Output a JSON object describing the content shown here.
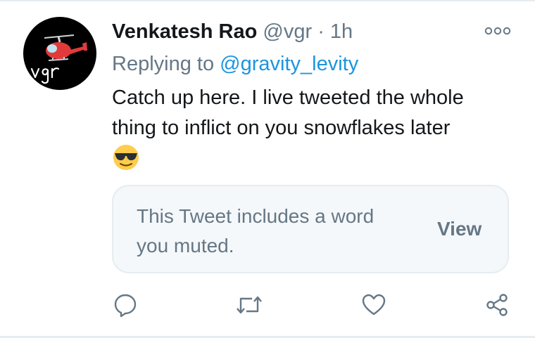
{
  "tweet": {
    "author_name": "Venkatesh Rao",
    "author_handle": "@vgr",
    "separator": "·",
    "time": "1h",
    "replying_prefix": "Replying to",
    "replying_handle": "@gravity_levity",
    "text": "Catch up here. I live tweeted the whole thing to inflict on you snowflakes later",
    "emoji": "smiling-face-with-sunglasses"
  },
  "avatar": {
    "monogram": "vgr",
    "bg": "#000000",
    "helicopter_color": "#e23a3a"
  },
  "muted_notice": {
    "text": "This Tweet includes a word you muted.",
    "view_label": "View"
  },
  "actions": {
    "icons": [
      "reply-icon",
      "retweet-icon",
      "like-icon",
      "share-icon"
    ]
  },
  "colors": {
    "accent": "#1b95e0",
    "secondary_text": "#657786",
    "primary_text": "#14171a",
    "card_bg": "#f5f8fa",
    "border": "#e6ecf0"
  }
}
